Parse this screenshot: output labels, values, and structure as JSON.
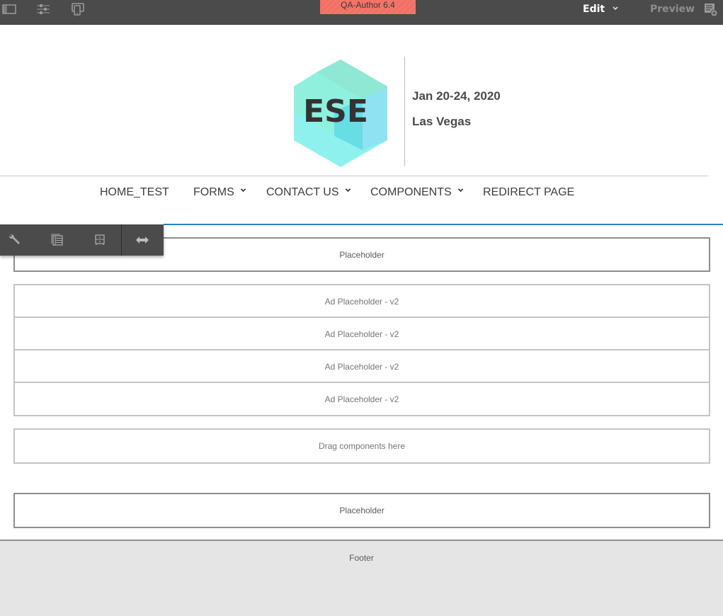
{
  "topbar": {
    "left_icons": [
      "side-panel-icon",
      "page-properties-icon",
      "emulator-icon"
    ],
    "environment_badge": "QA-Author 6.4",
    "mode": "Edit",
    "preview_label": "Preview",
    "annotate_icon": "annotate-icon",
    "colors": {
      "bar": "#4b4b4b",
      "badge": "#f56e63"
    }
  },
  "header": {
    "logo_text": "ESE",
    "date": "Jan 20-24, 2020",
    "city": "Las Vegas"
  },
  "nav": {
    "items": [
      {
        "label": "HOME_TEST",
        "has_dropdown": false
      },
      {
        "label": "FORMS",
        "has_dropdown": true
      },
      {
        "label": "CONTACT US",
        "has_dropdown": true
      },
      {
        "label": "COMPONENTS",
        "has_dropdown": true
      },
      {
        "label": "REDIRECT PAGE",
        "has_dropdown": false
      }
    ]
  },
  "component_toolbar": {
    "buttons": [
      "configure-wrench-icon",
      "layout-container-icon",
      "parent-icon",
      "resize-layout-icon"
    ]
  },
  "content": {
    "placeholder_top": "Placeholder",
    "ad_placeholders": [
      "Ad Placeholder - v2",
      "Ad Placeholder - v2",
      "Ad Placeholder - v2",
      "Ad Placeholder - v2"
    ],
    "drop_zone": "Drag components here",
    "placeholder_bottom": "Placeholder"
  },
  "footer": {
    "label": "Footer"
  }
}
